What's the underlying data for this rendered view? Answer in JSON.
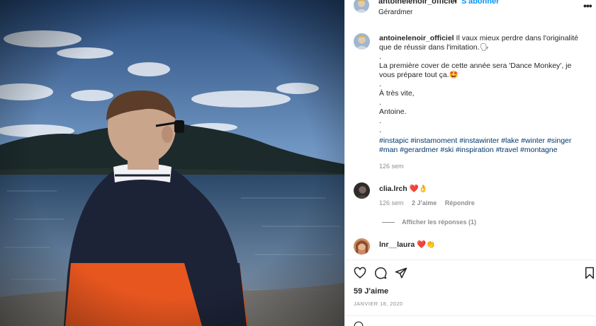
{
  "post": {
    "username": "antoinelenoir_officiel",
    "separator": "•",
    "follow_label": "S'abonner",
    "location": "Gérardmer",
    "more_icon": "more-horizontal-icon"
  },
  "caption": {
    "username": "antoinelenoir_officiel",
    "line1": "Il vaux mieux perdre dans l'originalité que de réussir dans l'imitation.🗣",
    "dot": ".",
    "line2": "La première cover de cette année sera 'Dance Monkey', je vous prépare tout ça.🤩",
    "line3": "À très vite,",
    "line4": "Antoine.",
    "hashtags": "#instapic #instamoment #instawinter #lake #winter #singer #man #gerardmer #ski #inspiration #travel #montagne",
    "time": "126 sem"
  },
  "comments": [
    {
      "username": "clia.lrch",
      "emoji": "❤️👌",
      "time": "126 sem",
      "likes": "2 J'aime",
      "reply": "Répondre",
      "view_replies": "Afficher les réponses (1)"
    },
    {
      "username": "lnr__laura",
      "emoji": "❤️👏"
    }
  ],
  "actions": {
    "like_icon": "heart-icon",
    "comment_icon": "comment-icon",
    "share_icon": "paper-plane-icon",
    "save_icon": "bookmark-icon"
  },
  "likes": "59 J'aime",
  "date": "JANVIER 18, 2020",
  "colors": {
    "link_blue": "#0095f6",
    "hashtag_blue": "#00376b",
    "muted": "#8e8e8e",
    "text": "#262626",
    "jacket_orange": "#e8561f",
    "jacket_navy": "#1d2336"
  }
}
